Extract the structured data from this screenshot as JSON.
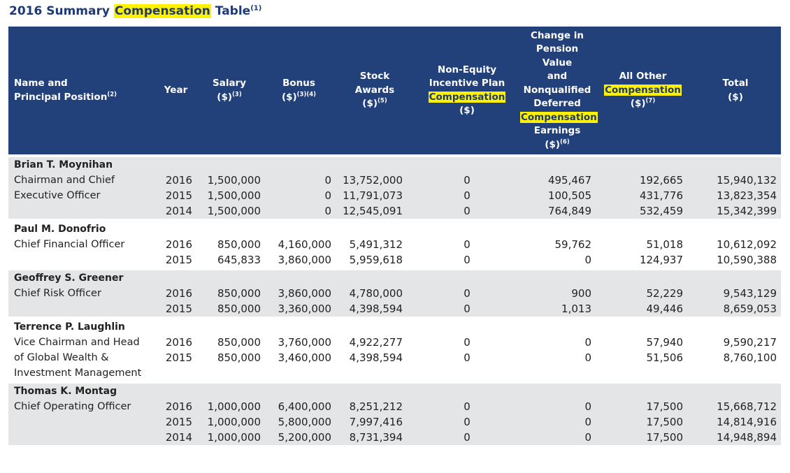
{
  "title": {
    "prefix": "2016 Summary",
    "highlight": "Compensation",
    "suffix": "Table",
    "note": "(1)"
  },
  "columns": {
    "name": {
      "line1": "Name and",
      "line2": "Principal Position",
      "note": "(2)"
    },
    "year": {
      "label": "Year"
    },
    "salary": {
      "line1": "Salary",
      "line2": "($)",
      "note": "(3)"
    },
    "bonus": {
      "line1": "Bonus",
      "line2": "($)",
      "note": "(3)(4)"
    },
    "stock": {
      "line1": "Stock",
      "line2": "Awards",
      "line3": "($)",
      "note": "(5)"
    },
    "nonequity": {
      "line1": "Non-Equity",
      "line2": "Incentive Plan",
      "highlight": "Compensation",
      "line4": "($)"
    },
    "pension": {
      "line1": "Change in",
      "line2": "Pension Value",
      "line3": "and",
      "line4": "Nonqualified",
      "line5": "Deferred",
      "highlight": "Compensation",
      "line7": "Earnings",
      "line8": "($)",
      "note": "(6)"
    },
    "other": {
      "line1": "All Other",
      "highlight": "Compensation",
      "line3": "($)",
      "note": "(7)"
    },
    "total": {
      "line1": "Total",
      "line2": "($)"
    }
  },
  "executives": [
    {
      "name": "Brian T. Moynihan",
      "position": [
        "Chairman and Chief",
        "Executive Officer",
        ""
      ],
      "rows": [
        {
          "year": "2016",
          "salary": "1,500,000",
          "bonus": "0",
          "stock": "13,752,000",
          "nonequity": "0",
          "pension": "495,467",
          "other": "192,665",
          "total": "15,940,132"
        },
        {
          "year": "2015",
          "salary": "1,500,000",
          "bonus": "0",
          "stock": "11,791,073",
          "nonequity": "0",
          "pension": "100,505",
          "other": "431,776",
          "total": "13,823,354"
        },
        {
          "year": "2014",
          "salary": "1,500,000",
          "bonus": "0",
          "stock": "12,545,091",
          "nonequity": "0",
          "pension": "764,849",
          "other": "532,459",
          "total": "15,342,399"
        }
      ]
    },
    {
      "name": "Paul M. Donofrio",
      "position": [
        "Chief Financial Officer",
        ""
      ],
      "rows": [
        {
          "year": "2016",
          "salary": "850,000",
          "bonus": "4,160,000",
          "stock": "5,491,312",
          "nonequity": "0",
          "pension": "59,762",
          "other": "51,018",
          "total": "10,612,092"
        },
        {
          "year": "2015",
          "salary": "645,833",
          "bonus": "3,860,000",
          "stock": "5,959,618",
          "nonequity": "0",
          "pension": "0",
          "other": "124,937",
          "total": "10,590,388"
        }
      ]
    },
    {
      "name": "Geoffrey S. Greener",
      "position": [
        "Chief Risk Officer",
        ""
      ],
      "rows": [
        {
          "year": "2016",
          "salary": "850,000",
          "bonus": "3,860,000",
          "stock": "4,780,000",
          "nonequity": "0",
          "pension": "900",
          "other": "52,229",
          "total": "9,543,129"
        },
        {
          "year": "2015",
          "salary": "850,000",
          "bonus": "3,360,000",
          "stock": "4,398,594",
          "nonequity": "0",
          "pension": "1,013",
          "other": "49,446",
          "total": "8,659,053"
        }
      ]
    },
    {
      "name": "Terrence P. Laughlin",
      "position": [
        "Vice Chairman and Head",
        "of Global Wealth &",
        "Investment Management"
      ],
      "rows": [
        {
          "year": "2016",
          "salary": "850,000",
          "bonus": "3,760,000",
          "stock": "4,922,277",
          "nonequity": "0",
          "pension": "0",
          "other": "57,940",
          "total": "9,590,217"
        },
        {
          "year": "2015",
          "salary": "850,000",
          "bonus": "3,460,000",
          "stock": "4,398,594",
          "nonequity": "0",
          "pension": "0",
          "other": "51,506",
          "total": "8,760,100"
        }
      ]
    },
    {
      "name": "Thomas K. Montag",
      "position": [
        "Chief Operating Officer",
        "",
        ""
      ],
      "rows": [
        {
          "year": "2016",
          "salary": "1,000,000",
          "bonus": "6,400,000",
          "stock": "8,251,212",
          "nonequity": "0",
          "pension": "0",
          "other": "17,500",
          "total": "15,668,712"
        },
        {
          "year": "2015",
          "salary": "1,000,000",
          "bonus": "5,800,000",
          "stock": "7,997,416",
          "nonequity": "0",
          "pension": "0",
          "other": "17,500",
          "total": "14,814,916"
        },
        {
          "year": "2014",
          "salary": "1,000,000",
          "bonus": "5,200,000",
          "stock": "8,731,394",
          "nonequity": "0",
          "pension": "0",
          "other": "17,500",
          "total": "14,948,894"
        }
      ]
    }
  ],
  "colors": {
    "header_bg": "#22407a",
    "title": "#1e3a74",
    "highlight": "#fff200",
    "row_shade": "#e4e5e7"
  }
}
